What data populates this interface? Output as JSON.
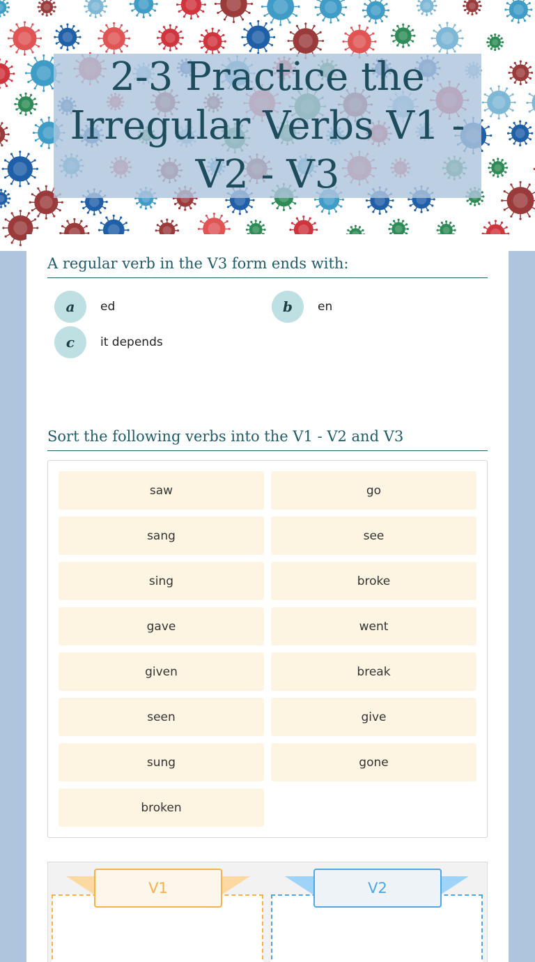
{
  "header": {
    "title": "2-3 Practice the Irregular Verbs V1 - V2 - V3"
  },
  "question1": {
    "prompt": "A regular verb in the V3 form ends with:",
    "options": [
      {
        "letter": "a",
        "text": "ed"
      },
      {
        "letter": "b",
        "text": "en"
      },
      {
        "letter": "c",
        "text": "it depends"
      }
    ]
  },
  "question2": {
    "prompt": "Sort the following verbs into the V1 - V2 and V3",
    "verbs": [
      "saw",
      "go",
      "sang",
      "see",
      "sing",
      "broke",
      "gave",
      "went",
      "given",
      "break",
      "seen",
      "give",
      "sung",
      "gone",
      "broken"
    ],
    "categories": [
      {
        "label": "V1",
        "color": "#f7b04a",
        "fill": "#fbd9a0"
      },
      {
        "label": "V2",
        "color": "#4da6e8",
        "fill": "#9fd3f7"
      }
    ]
  },
  "colors": {
    "page_bg": "#afc4dd",
    "heading": "#1d5b68",
    "option_bubble": "#bfe0e3",
    "verb_tile": "#fdf5e2"
  }
}
